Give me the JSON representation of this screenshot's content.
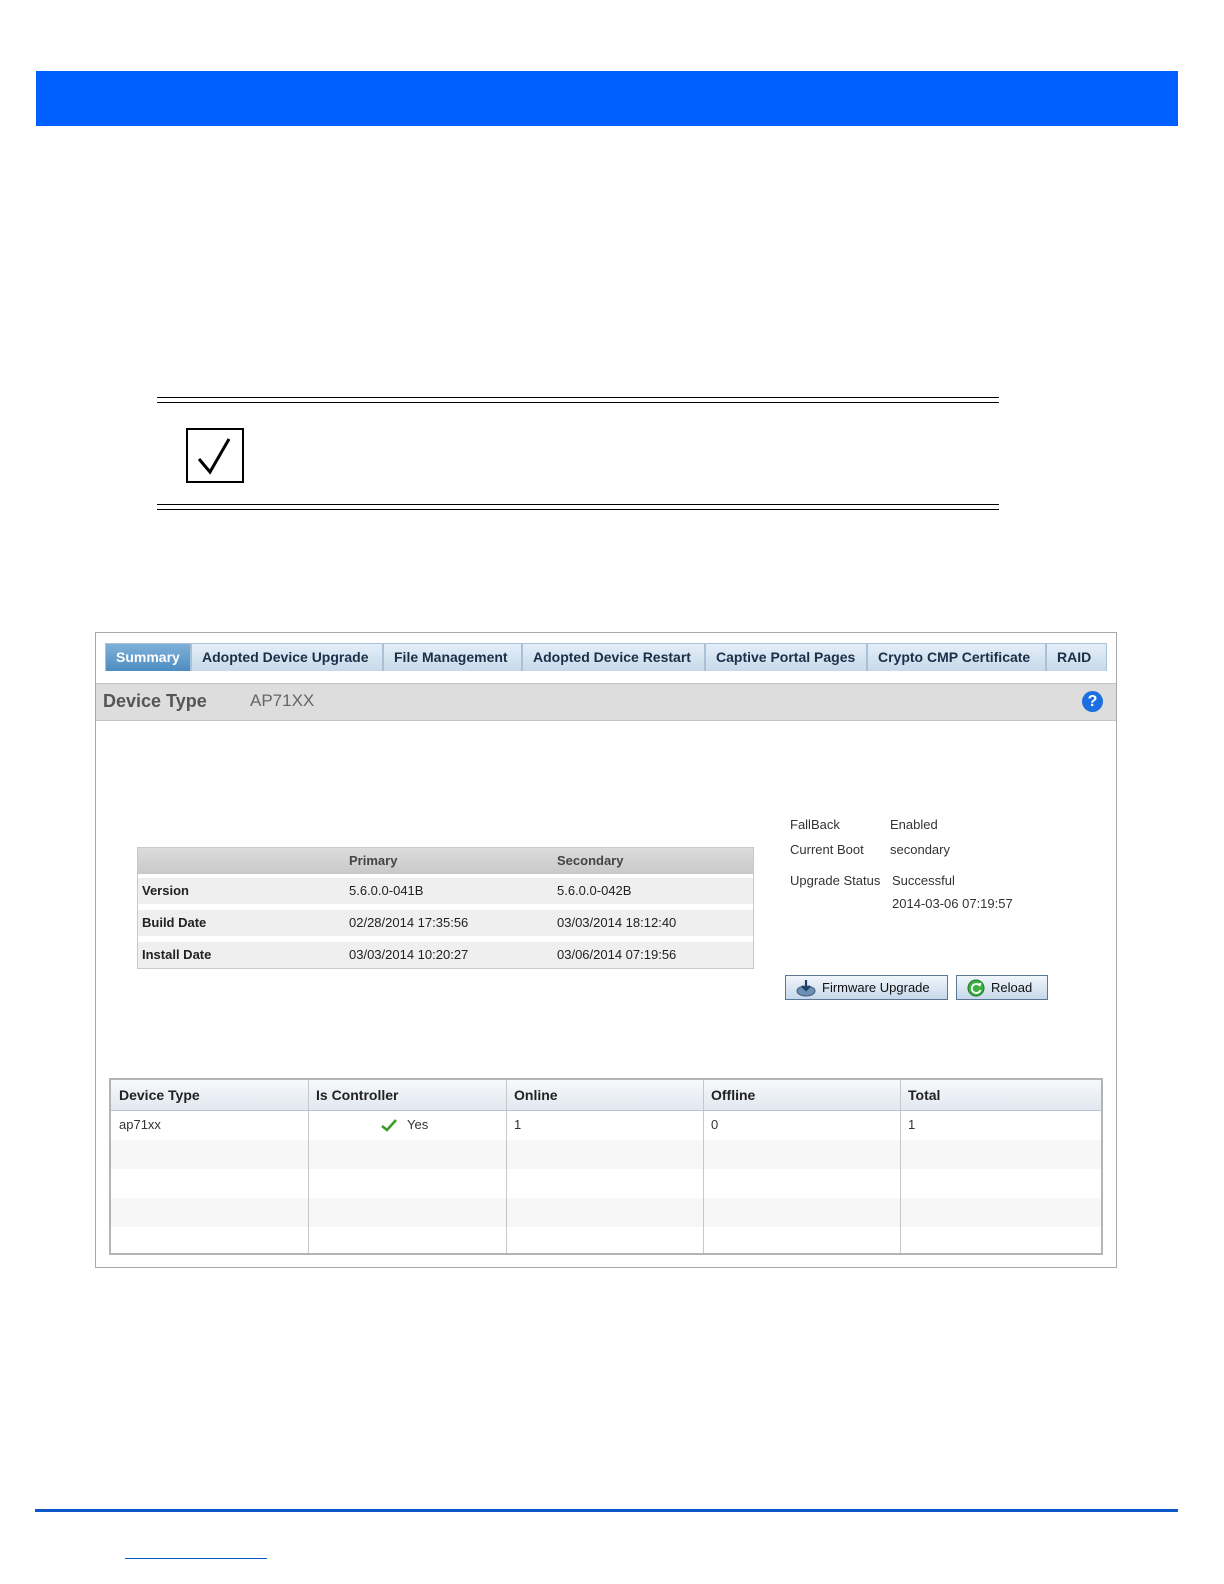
{
  "tabs": [
    "Summary",
    "Adopted Device Upgrade",
    "File Management",
    "Adopted Device Restart",
    "Captive Portal Pages",
    "Crypto CMP Certificate",
    "RAID"
  ],
  "device_bar": {
    "label": "Device Type",
    "value": "AP71XX",
    "help": "?"
  },
  "version_table": {
    "headers": [
      "",
      "Primary",
      "Secondary"
    ],
    "rows": [
      {
        "label": "Version",
        "primary": "5.6.0.0-041B",
        "secondary": "5.6.0.0-042B"
      },
      {
        "label": "Build Date",
        "primary": "02/28/2014 17:35:56",
        "secondary": "03/03/2014 18:12:40"
      },
      {
        "label": "Install Date",
        "primary": "03/03/2014 10:20:27",
        "secondary": "03/06/2014 07:19:56"
      }
    ]
  },
  "info": {
    "fallback_label": "FallBack",
    "fallback_value": "Enabled",
    "boot_label": "Current Boot",
    "boot_value": "secondary",
    "upgrade_label": "Upgrade Status",
    "upgrade_value": "Successful",
    "upgrade_time": "2014-03-06 07:19:57"
  },
  "buttons": {
    "firmware": "Firmware Upgrade",
    "reload": "Reload"
  },
  "grid": {
    "headers": [
      "Device Type",
      "Is Controller",
      "Online",
      "Offline",
      "Total"
    ],
    "row": {
      "device_type": "ap71xx",
      "is_controller": "Yes",
      "online": "1",
      "offline": "0",
      "total": "1"
    }
  },
  "colors": {
    "banner": "#0060ff",
    "active_tab": "#4d8dc2",
    "footer_rule": "#0d58c8"
  }
}
